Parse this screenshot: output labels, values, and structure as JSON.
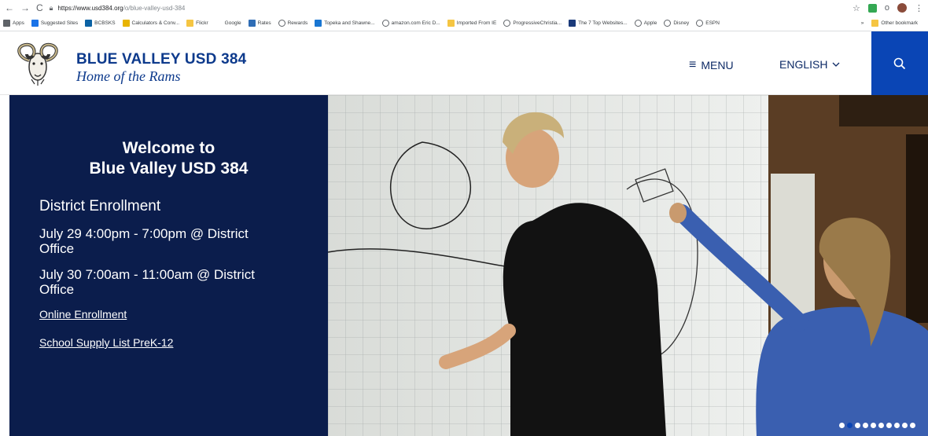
{
  "browser": {
    "url_host": "https://www.usd384.org",
    "url_path": "/o/blue-valley-usd-384",
    "bookmarks": [
      {
        "label": "Apps",
        "icon": "grid-icon"
      },
      {
        "label": "Suggested Sites",
        "icon": "suggested-icon"
      },
      {
        "label": "BCBSKS",
        "icon": "bcbs-icon"
      },
      {
        "label": "Calculators & Conv...",
        "icon": "b-icon"
      },
      {
        "label": "Flickr",
        "icon": "folder-icon"
      },
      {
        "label": "Google",
        "icon": "google-icon"
      },
      {
        "label": "Rates",
        "icon": "rates-icon"
      },
      {
        "label": "Rewards",
        "icon": "globe-icon"
      },
      {
        "label": "Topeka and Shawne...",
        "icon": "topeka-icon"
      },
      {
        "label": "amazon.com Eric D...",
        "icon": "globe-icon"
      },
      {
        "label": "Imported From IE",
        "icon": "folder-icon"
      },
      {
        "label": "ProgressiveChristia...",
        "icon": "globe-icon"
      },
      {
        "label": "The 7 Top Websites...",
        "icon": "f-icon"
      },
      {
        "label": "Apple",
        "icon": "globe-icon"
      },
      {
        "label": "Disney",
        "icon": "globe-icon"
      },
      {
        "label": "ESPN",
        "icon": "globe-icon"
      }
    ],
    "more_label": "»",
    "other_bookmarks": "Other bookmark"
  },
  "site": {
    "title": "BLUE VALLEY USD 384",
    "subtitle": "Home of the Rams",
    "menu_label": "MENU",
    "language_label": "ENGLISH"
  },
  "hero": {
    "welcome_line1": "Welcome to",
    "welcome_line2": "Blue Valley USD 384",
    "heading": "District Enrollment",
    "line1": "July 29 4:00pm - 7:00pm @ District Office",
    "line2": "July 30 7:00am - 11:00am @ District Office",
    "link1": "Online Enrollment",
    "link2": "School Supply List PreK-12",
    "slide_count": 10,
    "active_slide": 2
  },
  "colors": {
    "brand_blue": "#0d3a8c",
    "panel_navy": "#0b1d4c",
    "search_blue": "#0a45b5"
  }
}
